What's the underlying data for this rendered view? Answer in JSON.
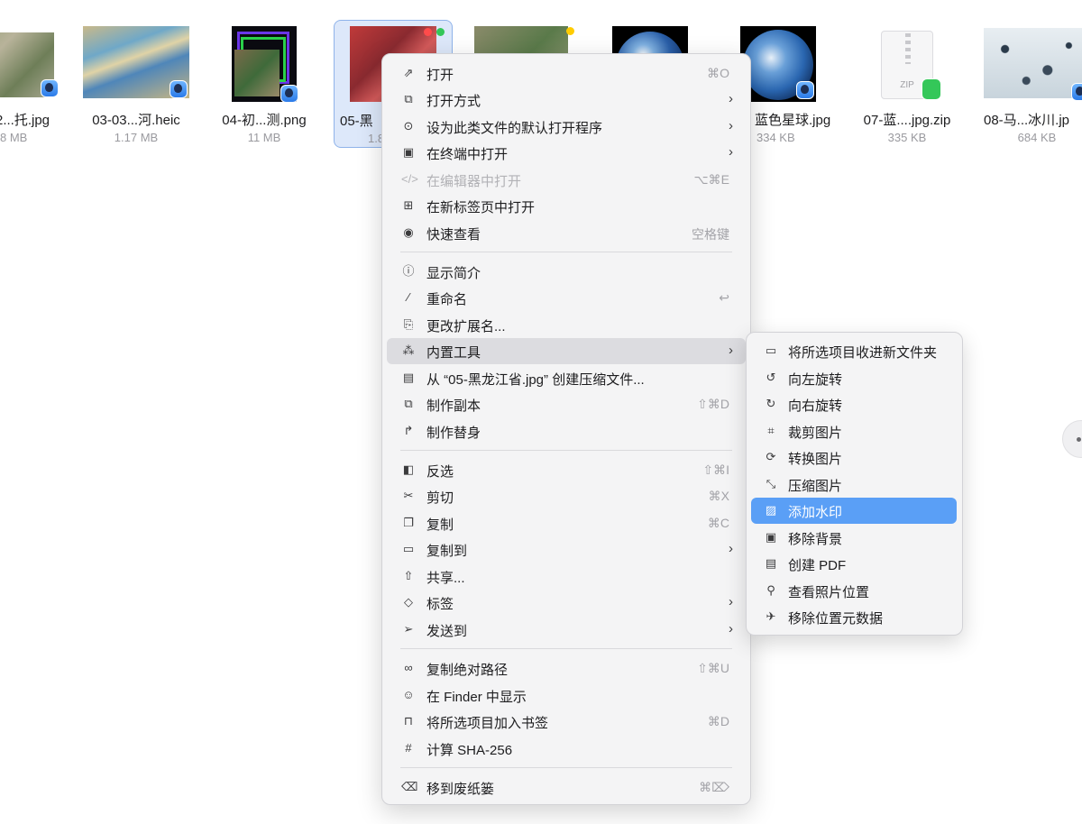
{
  "files": [
    {
      "name": "2...托.jpg",
      "size": "8 MB"
    },
    {
      "name": "03-03...河.heic",
      "size": "1.17 MB"
    },
    {
      "name": "04-初...测.png",
      "size": "11 MB"
    },
    {
      "name": "05-黑",
      "size": "1.8"
    },
    {
      "name": "",
      "size": ""
    },
    {
      "name": "",
      "size": ""
    },
    {
      "name": "蓝色星球.jpg",
      "size": "334 KB"
    },
    {
      "name": "07-蓝....jpg.zip",
      "size": "335 KB"
    },
    {
      "name": "08-马...冰川.jp",
      "size": "684 KB"
    }
  ],
  "zip_badge": "ZIP",
  "menu": {
    "items": [
      {
        "icon": "open-icon",
        "label": "打开",
        "shortcut": "⌘O"
      },
      {
        "icon": "open-with-icon",
        "label": "打开方式",
        "submenu": true
      },
      {
        "icon": "default-app-icon",
        "label": "设为此类文件的默认打开程序",
        "submenu": true
      },
      {
        "icon": "terminal-icon",
        "label": "在终端中打开",
        "submenu": true
      },
      {
        "icon": "code-icon",
        "label": "在编辑器中打开",
        "shortcut": "⌥⌘E",
        "disabled": true
      },
      {
        "icon": "new-tab-icon",
        "label": "在新标签页中打开"
      },
      {
        "icon": "eye-icon",
        "label": "快速查看",
        "shortcut": "空格键"
      },
      {
        "icon": "info-icon",
        "label": "显示简介"
      },
      {
        "icon": "pencil-icon",
        "label": "重命名",
        "shortcut": "↩"
      },
      {
        "icon": "extension-icon",
        "label": "更改扩展名..."
      },
      {
        "icon": "magic-wand-icon",
        "label": "内置工具",
        "submenu": true,
        "hover": true
      },
      {
        "icon": "archive-icon",
        "label": "从 “05-黑龙江省.jpg” 创建压缩文件..."
      },
      {
        "icon": "duplicate-icon",
        "label": "制作副本",
        "shortcut": "⇧⌘D"
      },
      {
        "icon": "alias-icon",
        "label": "制作替身"
      },
      {
        "icon": "invert-selection-icon",
        "label": "反选",
        "shortcut": "⇧⌘I"
      },
      {
        "icon": "scissors-icon",
        "label": "剪切",
        "shortcut": "⌘X"
      },
      {
        "icon": "copy-icon",
        "label": "复制",
        "shortcut": "⌘C"
      },
      {
        "icon": "folder-icon",
        "label": "复制到",
        "submenu": true
      },
      {
        "icon": "share-icon",
        "label": "共享..."
      },
      {
        "icon": "tag-icon",
        "label": "标签",
        "submenu": true
      },
      {
        "icon": "send-icon",
        "label": "发送到",
        "submenu": true
      },
      {
        "icon": "link-icon",
        "label": "复制绝对路径",
        "shortcut": "⇧⌘U"
      },
      {
        "icon": "finder-icon",
        "label": "在 Finder 中显示"
      },
      {
        "icon": "bookmark-icon",
        "label": "将所选项目加入书签",
        "shortcut": "⌘D"
      },
      {
        "icon": "hash-icon",
        "label": "计算 SHA-256"
      },
      {
        "icon": "trash-icon",
        "label": "移到废纸篓",
        "shortcut": "⌘⌦"
      }
    ]
  },
  "submenu": {
    "items": [
      {
        "icon": "new-folder-icon",
        "label": "将所选项目收进新文件夹"
      },
      {
        "icon": "rotate-left-icon",
        "label": "向左旋转"
      },
      {
        "icon": "rotate-right-icon",
        "label": "向右旋转"
      },
      {
        "icon": "crop-icon",
        "label": "裁剪图片"
      },
      {
        "icon": "convert-icon",
        "label": "转换图片"
      },
      {
        "icon": "compress-icon",
        "label": "压缩图片"
      },
      {
        "icon": "watermark-icon",
        "label": "添加水印",
        "active": true
      },
      {
        "icon": "remove-background-icon",
        "label": "移除背景"
      },
      {
        "icon": "pdf-icon",
        "label": "创建 PDF"
      },
      {
        "icon": "location-pin-icon",
        "label": "查看照片位置"
      },
      {
        "icon": "remove-location-icon",
        "label": "移除位置元数据"
      }
    ]
  },
  "colors": {
    "menu_bg": "#f4f4f5",
    "hover": "#dcdce0",
    "accent": "#5a9ff6",
    "selection": "#b4cdf5"
  }
}
